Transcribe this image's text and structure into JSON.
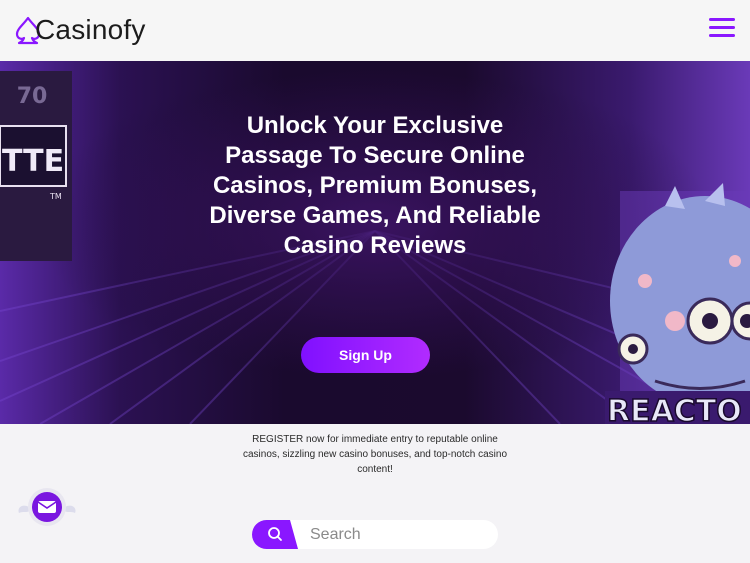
{
  "header": {
    "logo_text": "Casinofy",
    "logo_letter": "C",
    "menu_icon": "hamburger-menu-icon",
    "accent_color": "#8a17ff"
  },
  "hero": {
    "title": "Unlock Your Exclusive Passage To Secure Online Casinos, Premium Bonuses, Diverse Games, And Reliable Casino Reviews",
    "signup_label": "Sign Up",
    "slot_left_text": "TTE",
    "slot_left_top": "70",
    "slot_left_tm": "TM",
    "game_right_text": "REACTO"
  },
  "tagline": "REGISTER now for immediate entry to reputable online casinos, sizzling new casino bonuses, and top-notch casino content!",
  "search": {
    "placeholder": "Search",
    "icon": "search-icon"
  },
  "contact": {
    "icon": "mail-icon"
  }
}
